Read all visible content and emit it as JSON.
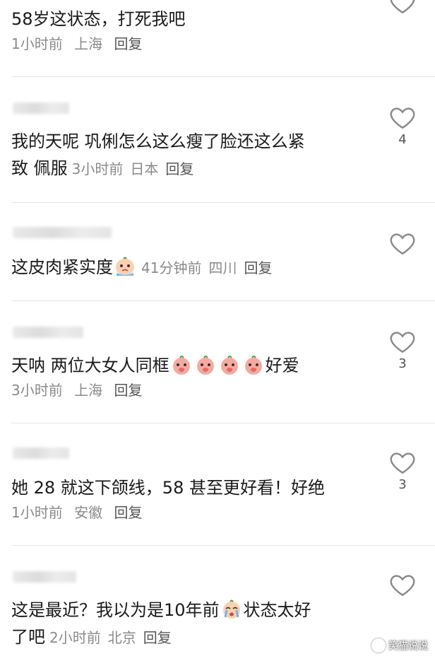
{
  "comments": [
    {
      "text": "58岁这状态，打死我吧",
      "time": "1小时前",
      "location": "上海",
      "reply": "回复",
      "likes": ""
    },
    {
      "text": "我的天呢 巩俐怎么这么瘦了脸还这么紧致 佩服",
      "text_line1": "我的天呢 巩俐怎么这么瘦了脸还这么紧",
      "text_line2": "致 佩服",
      "time": "3小时前",
      "location": "日本",
      "reply": "回复",
      "likes": "4"
    },
    {
      "text": "这皮肉紧实度",
      "time": "41分钟前",
      "location": "四川",
      "reply": "回复",
      "likes": ""
    },
    {
      "text_before": "天呐 两位大女人同框",
      "text_after": "好爱",
      "time": "3小时前",
      "location": "上海",
      "reply": "回复",
      "likes": "3"
    },
    {
      "text": "她 28 就这下颌线，58 甚至更好看！好绝",
      "time": "1小时前",
      "location": "安徽",
      "reply": "回复",
      "likes": "3"
    },
    {
      "text_before": "这是最近？我以为是10年前",
      "text_after": "状态太好",
      "text_line2": "了吧",
      "time": "2小时前",
      "location": "北京",
      "reply": "回复",
      "likes": ""
    }
  ],
  "watermark": "笑猫说说",
  "icons": {
    "like": "heart-outline-icon",
    "emoji_peach": "peach-face-emoji",
    "emoji_cry": "crying-face-emoji"
  },
  "colors": {
    "text": "#1a1a1a",
    "meta": "#8a8a8a",
    "divider": "#e6e6e6"
  }
}
